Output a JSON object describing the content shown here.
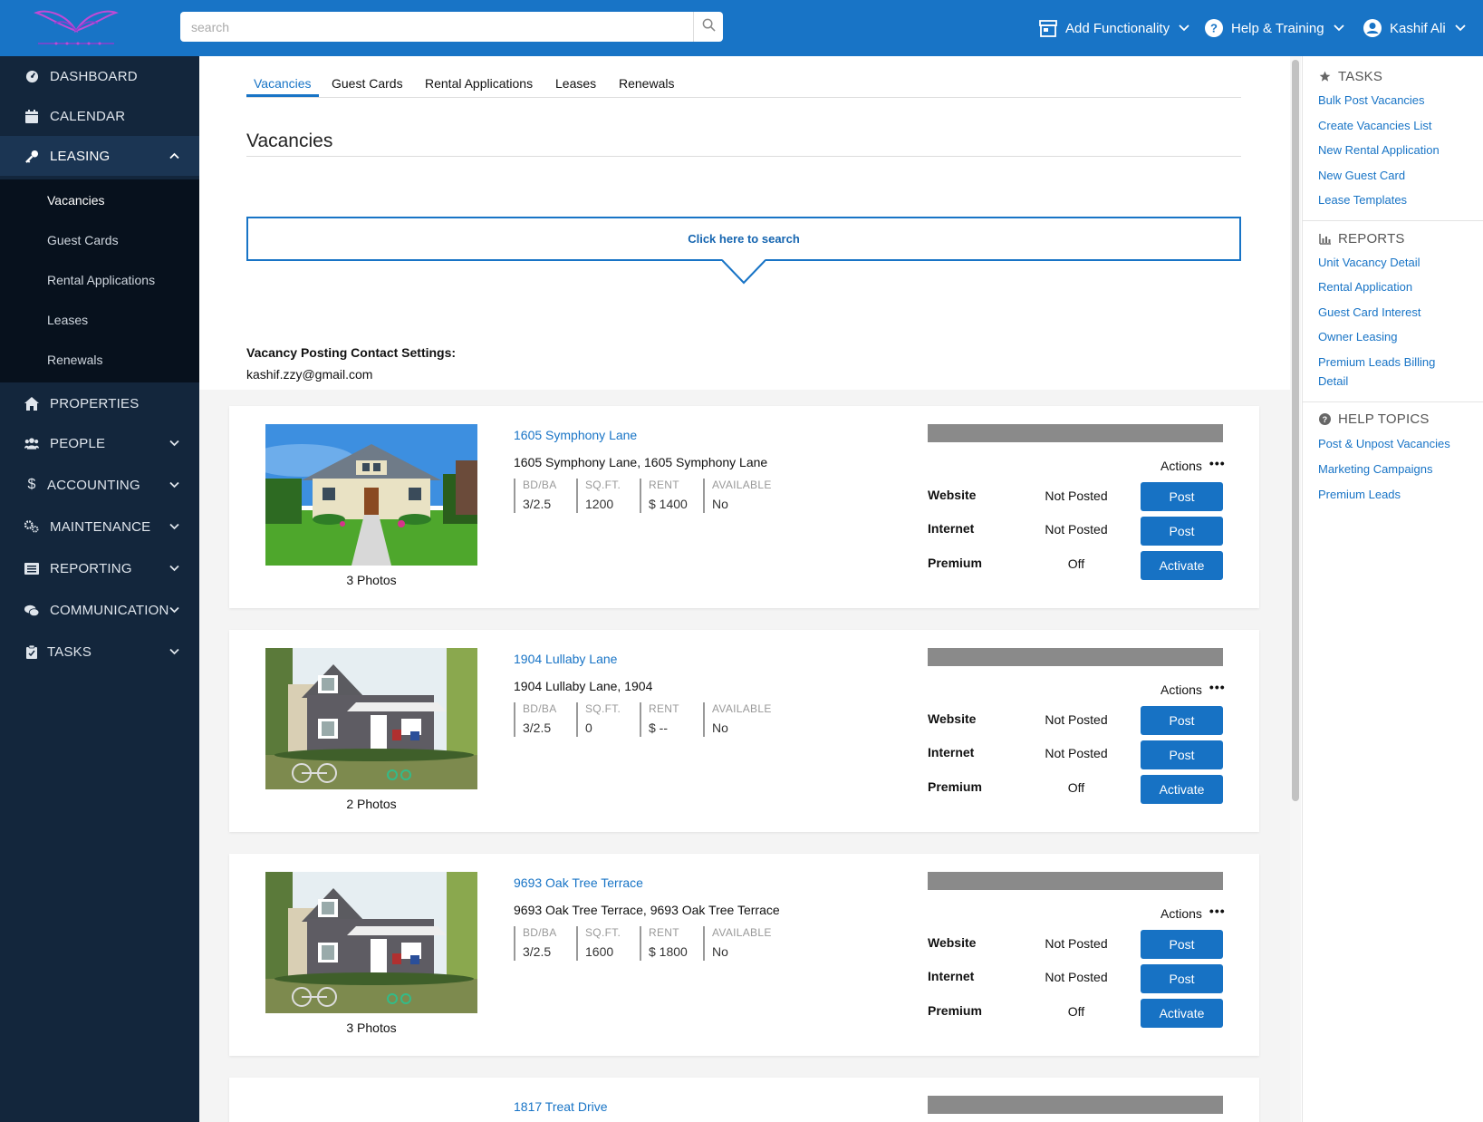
{
  "header": {
    "logo_alt": "company logo",
    "search_placeholder": "search",
    "add_functionality": "Add Functionality",
    "help_training": "Help & Training",
    "user_name": "Kashif Ali"
  },
  "sidebar": {
    "dashboard": "DASHBOARD",
    "calendar": "CALENDAR",
    "leasing": "LEASING",
    "sub": [
      "Vacancies",
      "Guest Cards",
      "Rental Applications",
      "Leases",
      "Renewals"
    ],
    "properties": "PROPERTIES",
    "people": "PEOPLE",
    "accounting": "ACCOUNTING",
    "maintenance": "MAINTENANCE",
    "reporting": "REPORTING",
    "communication": "COMMUNICATION",
    "tasks": "TASKS"
  },
  "tabs": [
    "Vacancies",
    "Guest Cards",
    "Rental Applications",
    "Leases",
    "Renewals"
  ],
  "page_title": "Vacancies",
  "search_prompt": "Click here to search",
  "contact": {
    "label": "Vacancy Posting Contact Settings:",
    "email": "kashif.zzy@gmail.com"
  },
  "stat_labels": {
    "bdba": "BD/BA",
    "sqft": "SQ.FT.",
    "rent": "RENT",
    "available": "AVAILABLE"
  },
  "row_labels": {
    "website": "Website",
    "internet": "Internet",
    "premium": "Premium"
  },
  "actions_label": "Actions",
  "actions_dots": "•••",
  "listings": [
    {
      "name": "1605 Symphony Lane",
      "address": "1605 Symphony Lane, 1605 Symphony Lane",
      "bdba": "3/2.5",
      "sqft": "1200",
      "rent": "$ 1400",
      "available": "No",
      "photos": "3 Photos",
      "website_status": "Not Posted",
      "internet_status": "Not Posted",
      "premium_status": "Off",
      "website_btn": "Post",
      "internet_btn": "Post",
      "premium_btn": "Activate"
    },
    {
      "name": "1904 Lullaby Lane",
      "address": "1904 Lullaby Lane, 1904",
      "bdba": "3/2.5",
      "sqft": "0",
      "rent": "$ --",
      "available": "No",
      "photos": "2 Photos",
      "website_status": "Not Posted",
      "internet_status": "Not Posted",
      "premium_status": "Off",
      "website_btn": "Post",
      "internet_btn": "Post",
      "premium_btn": "Activate"
    },
    {
      "name": "9693 Oak Tree Terrace",
      "address": "9693 Oak Tree Terrace, 9693 Oak Tree Terrace",
      "bdba": "3/2.5",
      "sqft": "1600",
      "rent": "$ 1800",
      "available": "No",
      "photos": "3 Photos",
      "website_status": "Not Posted",
      "internet_status": "Not Posted",
      "premium_status": "Off",
      "website_btn": "Post",
      "internet_btn": "Post",
      "premium_btn": "Activate"
    },
    {
      "name": "1817 Treat Drive"
    }
  ],
  "right_panel": {
    "tasks_title": "TASKS",
    "tasks": [
      "Bulk Post Vacancies",
      "Create Vacancies List",
      "New Rental Application",
      "New Guest Card",
      "Lease Templates"
    ],
    "reports_title": "REPORTS",
    "reports": [
      "Unit Vacancy Detail",
      "Rental Application",
      "Guest Card Interest",
      "Owner Leasing",
      "Premium Leads Billing Detail"
    ],
    "help_title": "HELP TOPICS",
    "help": [
      "Post & Unpost Vacancies",
      "Marketing Campaigns",
      "Premium Leads"
    ]
  },
  "colors": {
    "brand_blue": "#1874c6",
    "sidebar_bg": "#13263c",
    "sidebar_sub_bg": "#07111d",
    "button_blue": "#1772c4",
    "gray_bar": "#8a8a8a"
  }
}
